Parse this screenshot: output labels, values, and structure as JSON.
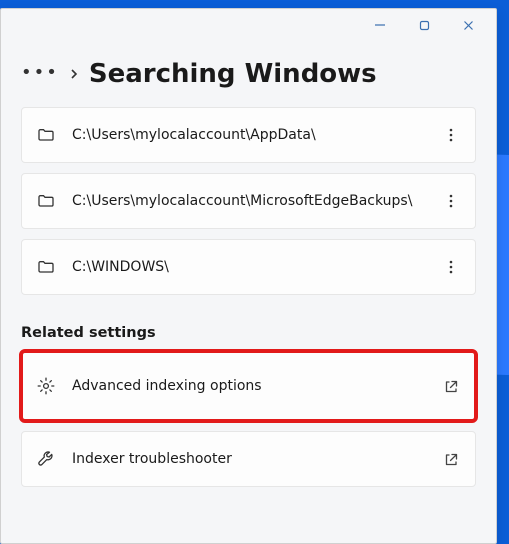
{
  "window": {
    "minimize_label": "Minimize",
    "maximize_label": "Maximize",
    "close_label": "Close"
  },
  "breadcrumb": {
    "more_label": "More",
    "title": "Searching Windows"
  },
  "excluded_folders": [
    {
      "label": "C:\\Users\\mylocalaccount\\AppData\\"
    },
    {
      "label": "C:\\Users\\mylocalaccount\\MicrosoftEdgeBackups\\"
    },
    {
      "label": "C:\\WINDOWS\\"
    }
  ],
  "related": {
    "section_label": "Related settings",
    "items": [
      {
        "label": "Advanced indexing options",
        "icon": "gear",
        "highlight": true
      },
      {
        "label": "Indexer troubleshooter",
        "icon": "wrench",
        "highlight": false
      }
    ]
  }
}
